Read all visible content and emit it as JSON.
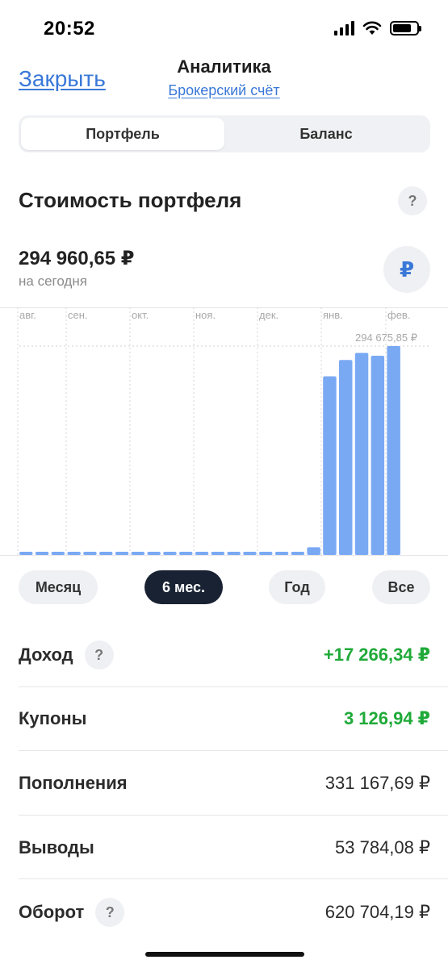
{
  "status_bar": {
    "time": "20:52"
  },
  "header": {
    "close_label": "Закрыть",
    "title": "Аналитика",
    "subtitle": "Брокерский счёт"
  },
  "tabs": [
    {
      "label": "Портфель",
      "active": true
    },
    {
      "label": "Баланс",
      "active": false
    }
  ],
  "portfolio": {
    "title": "Стоимость портфеля",
    "help_icon": "?",
    "value": "294 960,65 ₽",
    "value_caption": "на сегодня",
    "currency_symbol": "₽"
  },
  "chart_data": {
    "type": "bar",
    "month_labels": [
      "авг.",
      "сен.",
      "окт.",
      "ноя.",
      "дек.",
      "янв.",
      "фев."
    ],
    "values": [
      4500,
      4500,
      4500,
      4500,
      4500,
      4500,
      4500,
      4500,
      4500,
      4500,
      4500,
      4500,
      4500,
      4500,
      4500,
      4500,
      4500,
      4500,
      11000,
      252000,
      275000,
      285000,
      281000,
      294675.85
    ],
    "max_label": "294 675,85 ₽",
    "max_value": 294675.85,
    "bar_color": "#7aa9f4",
    "grid": true
  },
  "periods": [
    {
      "label": "Месяц",
      "active": false
    },
    {
      "label": "6 мес.",
      "active": true
    },
    {
      "label": "Год",
      "active": false
    },
    {
      "label": "Все",
      "active": false
    }
  ],
  "stats": [
    {
      "label": "Доход",
      "value": "+17 266,34 ₽",
      "green": true,
      "help": true
    },
    {
      "label": "Купоны",
      "value": "3 126,94 ₽",
      "green": true,
      "help": false
    },
    {
      "label": "Пополнения",
      "value": "331 167,69 ₽",
      "green": false,
      "help": false
    },
    {
      "label": "Выводы",
      "value": "53 784,08 ₽",
      "green": false,
      "help": false
    },
    {
      "label": "Оборот",
      "value": "620 704,19 ₽",
      "green": false,
      "help": true
    }
  ],
  "colors": {
    "accent": "#3a78d8",
    "positive": "#1faa38",
    "dark_chip": "#182233"
  }
}
